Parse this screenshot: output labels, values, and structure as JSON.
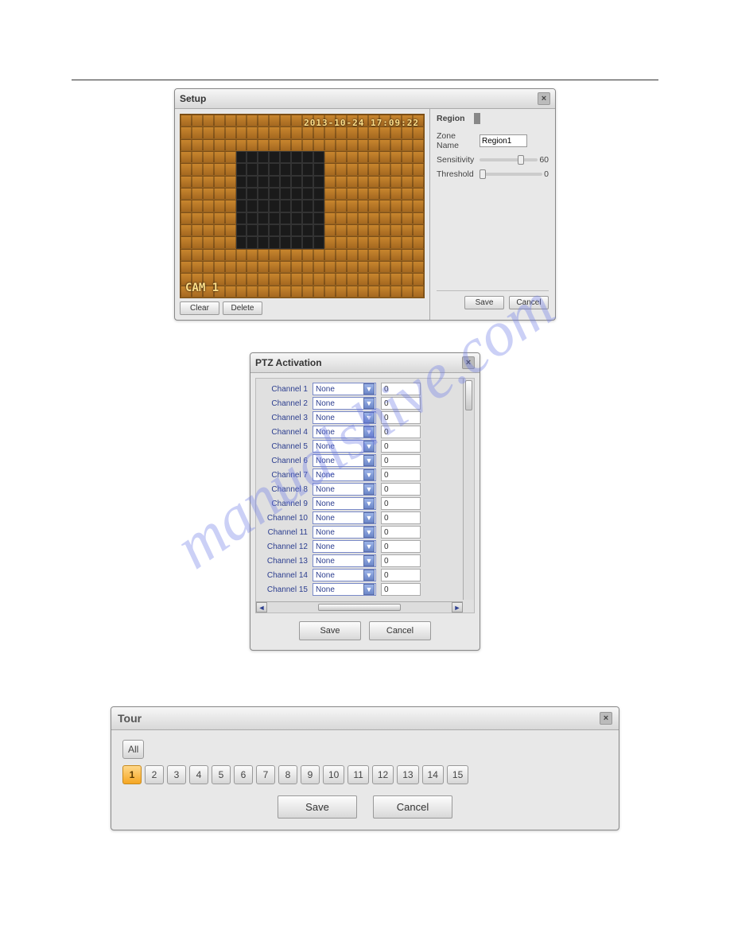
{
  "setup": {
    "title": "Setup",
    "timestamp": "2013-10-24 17:09:22",
    "camera_label": "CAM 1",
    "buttons": {
      "clear": "Clear",
      "delete": "Delete",
      "save": "Save",
      "cancel": "Cancel"
    },
    "region": {
      "label": "Region",
      "swatches": [
        "#e8a23a",
        "#e8d23a",
        "#5bd2e0",
        "#7ad66a"
      ],
      "zone_label": "Zone Name",
      "zone_value": "Region1",
      "sensitivity_label": "Sensitivity",
      "sensitivity_value": "60",
      "sensitivity_pct": 65,
      "threshold_label": "Threshold",
      "threshold_value": "0",
      "threshold_pct": 0
    },
    "grid": {
      "cols": 22,
      "rows": 15,
      "sel_c0": 5,
      "sel_c1": 12,
      "sel_r0": 3,
      "sel_r1": 10
    }
  },
  "ptz": {
    "title": "PTZ Activation",
    "save": "Save",
    "cancel": "Cancel",
    "option_none": "None",
    "channels": [
      {
        "label": "Channel 1",
        "preset": "None",
        "num": "0"
      },
      {
        "label": "Channel 2",
        "preset": "None",
        "num": "0"
      },
      {
        "label": "Channel 3",
        "preset": "None",
        "num": "0"
      },
      {
        "label": "Channel 4",
        "preset": "None",
        "num": "0"
      },
      {
        "label": "Channel 5",
        "preset": "None",
        "num": "0"
      },
      {
        "label": "Channel 6",
        "preset": "None",
        "num": "0"
      },
      {
        "label": "Channel 7",
        "preset": "None",
        "num": "0"
      },
      {
        "label": "Channel 8",
        "preset": "None",
        "num": "0"
      },
      {
        "label": "Channel 9",
        "preset": "None",
        "num": "0"
      },
      {
        "label": "Channel 10",
        "preset": "None",
        "num": "0"
      },
      {
        "label": "Channel 11",
        "preset": "None",
        "num": "0"
      },
      {
        "label": "Channel 12",
        "preset": "None",
        "num": "0"
      },
      {
        "label": "Channel 13",
        "preset": "None",
        "num": "0"
      },
      {
        "label": "Channel 14",
        "preset": "None",
        "num": "0"
      },
      {
        "label": "Channel 15",
        "preset": "None",
        "num": "0"
      }
    ]
  },
  "tour": {
    "title": "Tour",
    "all": "All",
    "save": "Save",
    "cancel": "Cancel",
    "active": 1,
    "items": [
      "1",
      "2",
      "3",
      "4",
      "5",
      "6",
      "7",
      "8",
      "9",
      "10",
      "11",
      "12",
      "13",
      "14",
      "15"
    ]
  },
  "watermark": "manualshive.com"
}
